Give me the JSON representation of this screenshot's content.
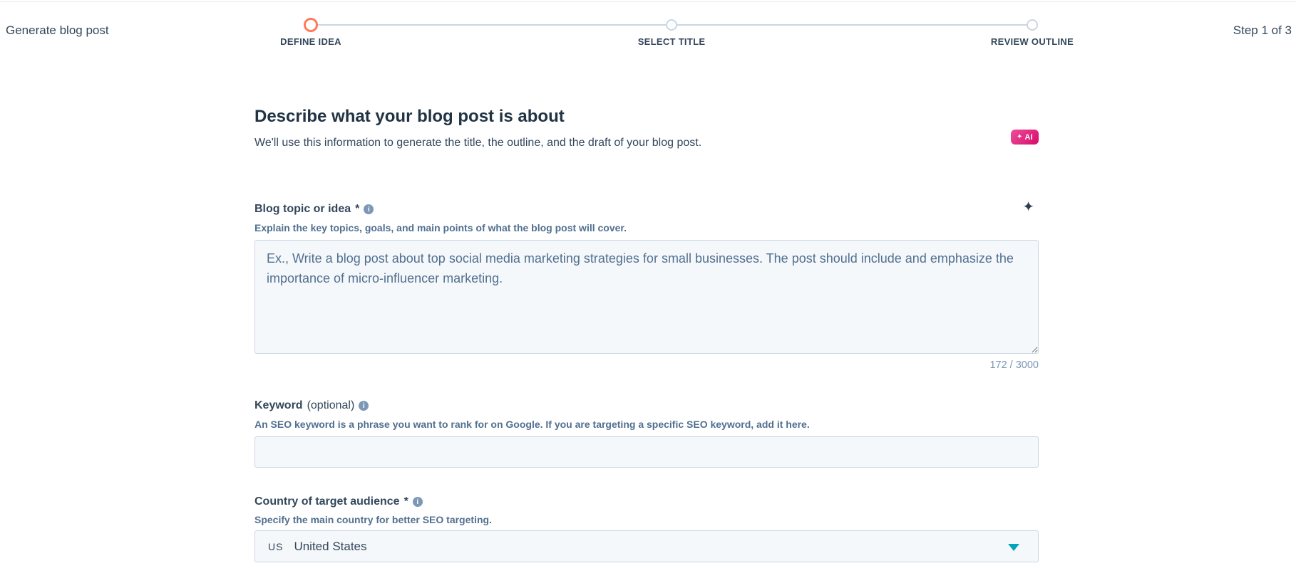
{
  "header": {
    "page_title": "Generate blog post",
    "step_indicator": "Step 1 of 3",
    "steps": [
      {
        "label": "DEFINE IDEA",
        "state": "active"
      },
      {
        "label": "SELECT TITLE",
        "state": "upcoming"
      },
      {
        "label": "REVIEW OUTLINE",
        "state": "upcoming"
      }
    ]
  },
  "main": {
    "heading": "Describe what your blog post is about",
    "subtitle": "We'll use this information to generate the title, the outline, and the draft of your blog post.",
    "ai_badge_label": "AI",
    "fields": {
      "topic": {
        "label": "Blog topic or idea",
        "required_marker": "*",
        "helper": "Explain the key topics, goals, and main points of what the blog post will cover.",
        "value": "Ex., Write a blog post about top social media marketing strategies for small businesses. The post should include and emphasize the importance of micro-influencer marketing.",
        "char_count": "172 / 3000"
      },
      "keyword": {
        "label": "Keyword",
        "optional_marker": "(optional)",
        "helper": "An SEO keyword is a phrase you want to rank for on Google. If you are targeting a specific SEO keyword, add it here.",
        "value": ""
      },
      "country": {
        "label": "Country of target audience",
        "required_marker": "*",
        "helper": "Specify the main country for better SEO targeting.",
        "flag_code": "US",
        "value": "United States"
      }
    }
  },
  "icons": {
    "sparkle_glyph": "✦",
    "info_glyph": "i"
  },
  "colors": {
    "accent_orange": "#ff7a59",
    "step_inactive": "#cbd6e2",
    "ai_badge_gradient_start": "#ee4e9a",
    "ai_badge_gradient_end": "#d60b6a",
    "caret_teal": "#00a4bd",
    "field_background": "#f5f8fa",
    "field_border": "#cbd6e2",
    "heading_text": "#213343",
    "body_text": "#33475b",
    "helper_text": "#516f90",
    "counter_text": "#7c98b6"
  }
}
